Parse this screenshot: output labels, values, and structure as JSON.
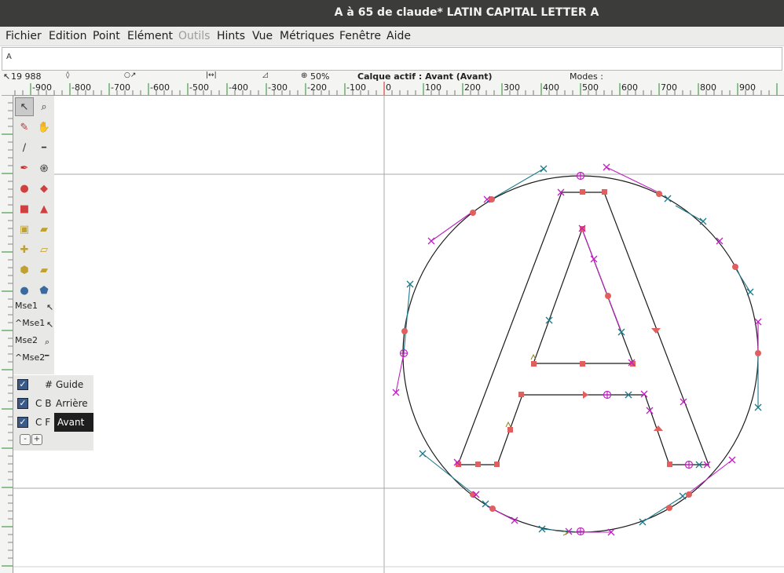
{
  "window": {
    "title": "A à 65 de claude* LATIN CAPITAL LETTER A"
  },
  "menu": [
    "Fichier",
    "Edition",
    "Point",
    "Elément",
    "Outils",
    "Hints",
    "Vue",
    "Métriques",
    "Fenêtre",
    "Aide"
  ],
  "menu_disabled": "Outils",
  "charline": {
    "text": "A"
  },
  "infobar": {
    "coords": "19 988",
    "zoom": "50%",
    "active_layer": "Calque actif : Avant (Avant)",
    "modes": "Modes :"
  },
  "hruler": {
    "labels": [
      "-900",
      "-800",
      "-700",
      "-600",
      "-500",
      "-400",
      "-300",
      "-200",
      "-100",
      "0",
      "100",
      "200",
      "300",
      "400",
      "500",
      "600",
      "700",
      "800",
      "900"
    ]
  },
  "tools": [
    {
      "name": "pointer-tool",
      "icon": "pointer-icon"
    },
    {
      "name": "magnify-tool",
      "icon": "magnify-icon"
    },
    {
      "name": "freehand-tool",
      "icon": "pencil-icon"
    },
    {
      "name": "scroll-tool",
      "icon": "hand-icon"
    },
    {
      "name": "knife-tool",
      "icon": "knife-icon"
    },
    {
      "name": "ruler-tool",
      "icon": "ruler-icon"
    },
    {
      "name": "pen-tool",
      "icon": "pen-icon"
    },
    {
      "name": "spiro-tool",
      "icon": "spiral-icon"
    },
    {
      "name": "curve-point-tool",
      "icon": "curve-point-icon"
    },
    {
      "name": "hv-curve-point-tool",
      "icon": "hv-curve-point-icon"
    },
    {
      "name": "corner-point-tool",
      "icon": "corner-point-icon"
    },
    {
      "name": "tangent-point-tool",
      "icon": "tangent-point-icon"
    },
    {
      "name": "scale-tool",
      "icon": "scale-icon"
    },
    {
      "name": "rotate-tool",
      "icon": "rotate-icon"
    },
    {
      "name": "flip-tool",
      "icon": "flip-icon"
    },
    {
      "name": "skew-tool",
      "icon": "skew-icon"
    },
    {
      "name": "3d-rotate-tool",
      "icon": "cube-icon"
    },
    {
      "name": "perspective-tool",
      "icon": "perspective-icon"
    },
    {
      "name": "ellipse-tool",
      "icon": "ellipse-icon"
    },
    {
      "name": "polygon-tool",
      "icon": "polygon-icon"
    }
  ],
  "mouse_labels": [
    "Mse1",
    "^Mse1",
    "Mse2",
    "^Mse2"
  ],
  "layers": [
    {
      "code": "#",
      "name": "Guide"
    },
    {
      "code": "C B",
      "name": "Arrière"
    },
    {
      "code": "C F",
      "name": "Avant"
    }
  ],
  "layer_buttons": [
    "-",
    "+"
  ],
  "colors": {
    "outline": "#1a1a1a",
    "control_teal": "#1a7a8a",
    "control_magenta": "#c020c0",
    "point_red": "#e06060",
    "guide": "#a8a8a8"
  }
}
